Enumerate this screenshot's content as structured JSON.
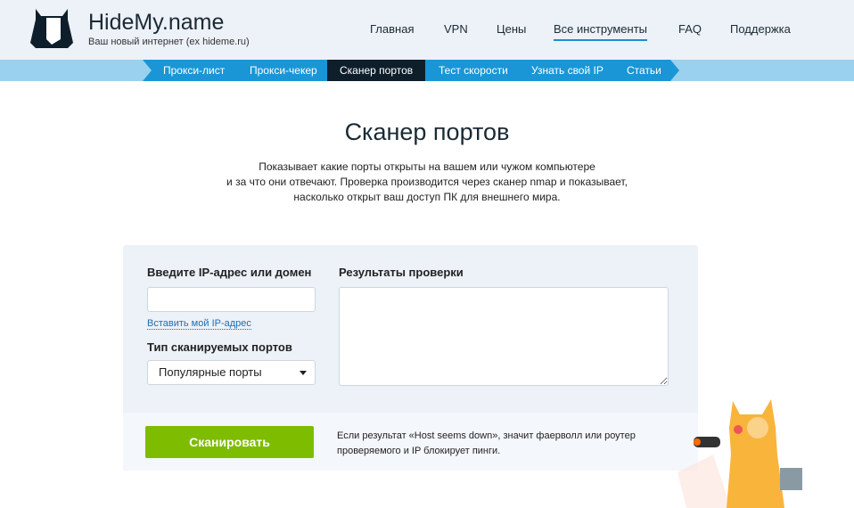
{
  "header": {
    "brand": "HideMy.name",
    "tagline": "Ваш новый интернет (ex hideme.ru)",
    "nav": [
      "Главная",
      "VPN",
      "Цены",
      "Все инструменты",
      "FAQ",
      "Поддержка"
    ]
  },
  "subnav": [
    "Прокси-лист",
    "Прокси-чекер",
    "Сканер портов",
    "Тест скорости",
    "Узнать свой IP",
    "Статьи"
  ],
  "page": {
    "title": "Сканер портов",
    "desc": [
      "Показывает какие порты открыты на вашем или чужом компьютере",
      "и за что они отвечают. Проверка производится через сканер nmap и показывает,",
      "насколько открыт ваш доступ ПК для внешнего мира."
    ]
  },
  "form": {
    "ip_label": "Введите IP-адрес или домен",
    "ip_value": "",
    "insert_link": "Вставить мой IP-адрес",
    "type_label": "Тип сканируемых портов",
    "type_value": "Популярные порты",
    "results_label": "Результаты проверки",
    "scan_button": "Сканировать",
    "note": "Если результат «Host seems down», значит фаерволл или роутер проверяемого и IP блокирует пинги."
  }
}
